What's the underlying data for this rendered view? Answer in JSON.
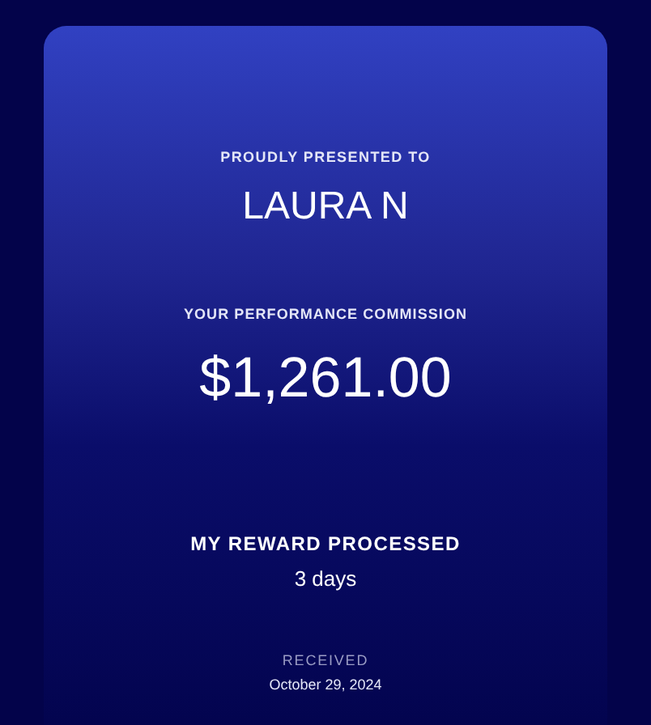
{
  "certificate": {
    "presented_label": "PROUDLY PRESENTED TO",
    "recipient": "LAURA N",
    "commission_label": "YOUR PERFORMANCE COMMISSION",
    "commission_amount": "$1,261.00"
  },
  "processed": {
    "label": "MY REWARD PROCESSED",
    "value": "3 days"
  },
  "received": {
    "label": "RECEIVED",
    "date": "October 29, 2024"
  }
}
